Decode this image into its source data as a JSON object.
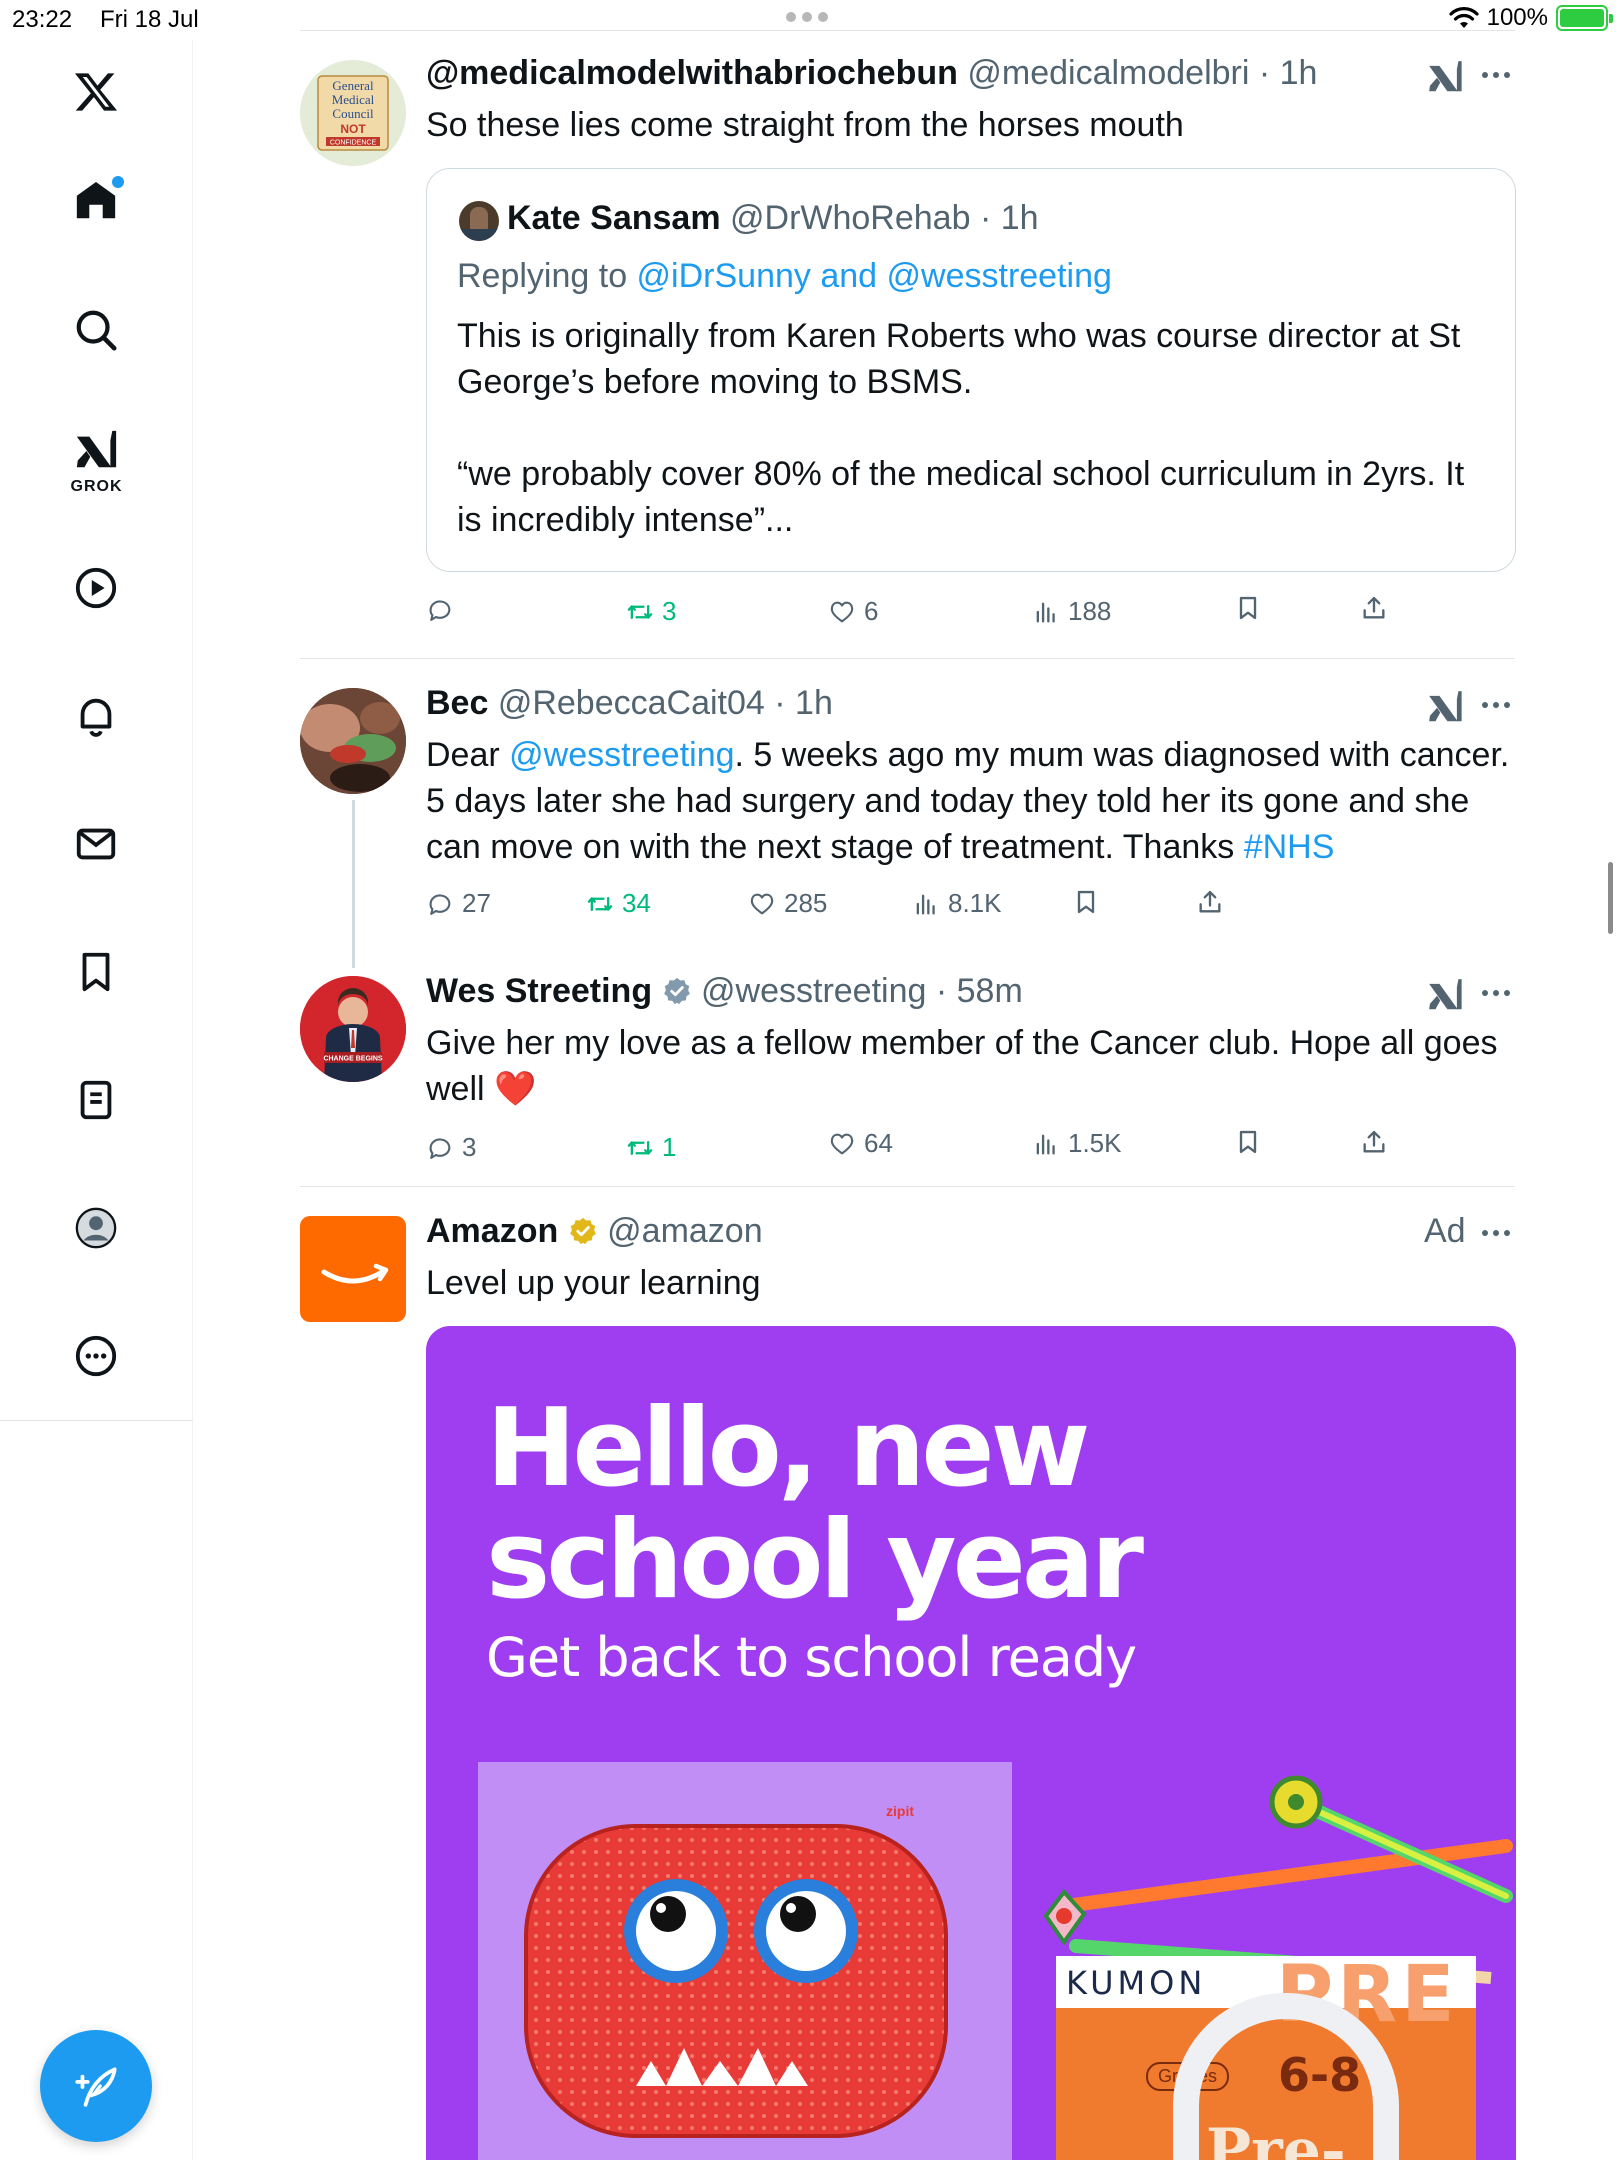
{
  "status_bar": {
    "time": "23:22",
    "date": "Fri 18 Jul",
    "battery": "100%"
  },
  "sidebar": {
    "items": [
      {
        "name": "home",
        "icon": "home-icon"
      },
      {
        "name": "explore",
        "icon": "search-icon"
      },
      {
        "name": "grok",
        "icon": "grok-icon",
        "label": "GROK"
      },
      {
        "name": "videos",
        "icon": "play-icon"
      },
      {
        "name": "notifications",
        "icon": "bell-icon"
      },
      {
        "name": "messages",
        "icon": "mail-icon"
      },
      {
        "name": "bookmarks",
        "icon": "bookmark-icon"
      },
      {
        "name": "lists",
        "icon": "list-icon"
      },
      {
        "name": "profile",
        "icon": "profile-icon"
      },
      {
        "name": "more",
        "icon": "more-circle-icon"
      }
    ]
  },
  "colors": {
    "accent": "#1d9bf0",
    "retweet": "#00ba7c",
    "muted": "#536471",
    "ad_bg": "#9f3ef0",
    "amazon": "#ff6a00"
  },
  "tweets": [
    {
      "name": "@medicalmodelwithabriochebun",
      "handle": "@medicalmodelbri",
      "time": "1h",
      "text": "So these lies come straight from the horses mouth",
      "avatar_text": {
        "line1": "General",
        "line2": "Medical",
        "line3": "Council",
        "line4": "NOT",
        "line5": "CONFIDENCE"
      },
      "quote": {
        "name": "Kate Sansam",
        "handle": "@DrWhoRehab",
        "time": "1h",
        "replying_prefix": "Replying to ",
        "replying_to": "@iDrSunny and @wesstreeting",
        "text1_line1": "This is originally from Karen Roberts who was course director at St",
        "text1_line2": "George’s before moving to  BSMS.",
        "text2_line1": "“we probably cover 80% of the medical school curriculum in 2yrs. It",
        "text2_line2": "is incredibly intense”..."
      },
      "stats": {
        "replies": "",
        "retweets": "3",
        "likes": "6",
        "views": "188"
      }
    },
    {
      "name": "Bec",
      "handle": "@RebeccaCait04",
      "time": "1h",
      "text_prefix": "Dear ",
      "mention": "@wesstreeting",
      "text_line1_rest": ".  5 weeks ago my mum was diagnosed with cancer.",
      "text_line2": "5 days later she had surgery and today they told her its gone and she",
      "text_line3_prefix": "can move on with the next stage of treatment.  Thanks ",
      "hashtag": "#NHS",
      "stats": {
        "replies": "27",
        "retweets": "34",
        "likes": "285",
        "views": "8.1K"
      }
    },
    {
      "name": "Wes Streeting",
      "handle": "@wesstreeting",
      "time": "58m",
      "text_line1": "Give her my love as a fellow member of the Cancer club. Hope all goes",
      "text_line2": "well",
      "emoji": "❤️",
      "avatar_text": "CHANGE BEGINS",
      "stats": {
        "replies": "3",
        "retweets": "1",
        "likes": "64",
        "views": "1.5K"
      }
    },
    {
      "name": "Amazon",
      "handle": "@amazon",
      "ad_label": "Ad",
      "text": "Level up your learning",
      "image": {
        "headline_line1": "Hello, new",
        "headline_line2": "school year",
        "subline": "Get back to school ready",
        "case_brand": "zipit",
        "book_brand": "KUMON",
        "book_grades_label": "Grades",
        "book_grades": "6-8",
        "book_title": "Pre-",
        "book_bg_text": "PRE"
      }
    }
  ]
}
